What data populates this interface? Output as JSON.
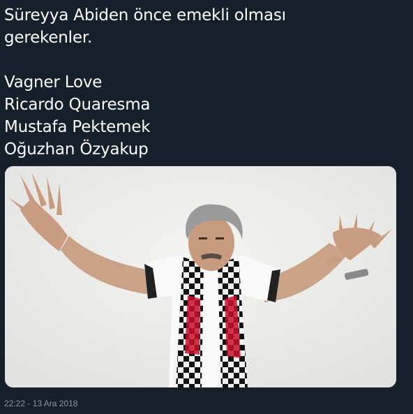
{
  "tweet": {
    "text_lines": [
      "Süreyya Abiden önce emekli olması",
      "gerekenler."
    ],
    "list": [
      "Vagner Love",
      "Ricardo Quaresma",
      "Mustafa Pektemek",
      "Oğuzhan Özyakup"
    ],
    "timestamp": "22:22 - 13 Ara 2018"
  },
  "media": {
    "icon": "photo-of-man-in-football-scarf"
  },
  "colors": {
    "background": "#15202b",
    "text": "#ffffff",
    "muted": "#8899a6"
  }
}
